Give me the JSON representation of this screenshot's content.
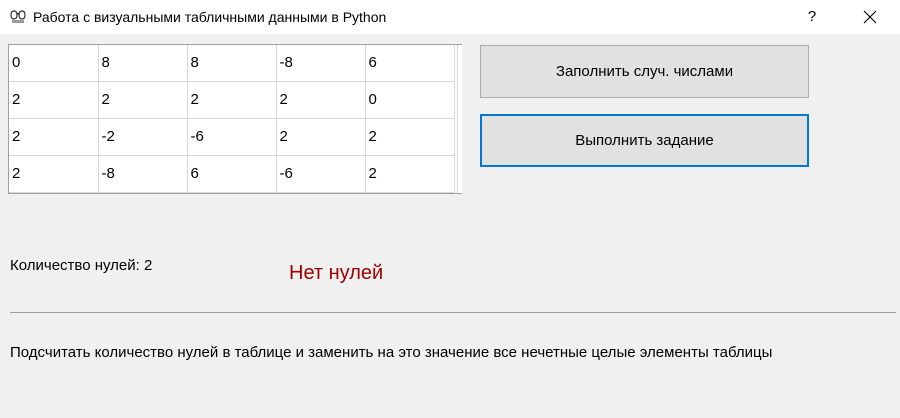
{
  "window": {
    "title": "Работа с визуальными табличными данными в Python",
    "help_label": "?",
    "icon": "glasses-icon"
  },
  "table": {
    "rows": [
      [
        "0",
        "8",
        "8",
        "-8",
        "6"
      ],
      [
        "2",
        "2",
        "2",
        "2",
        "0"
      ],
      [
        "2",
        "-2",
        "-6",
        "2",
        "2"
      ],
      [
        "2",
        "-8",
        "6",
        "-6",
        "2"
      ]
    ]
  },
  "buttons": {
    "fill_random": "Заполнить случ. числами",
    "run_task": "Выполнить задание"
  },
  "results": {
    "zero_count_text": "Количество нулей: 2",
    "status_text": "Нет нулей",
    "status_color": "#a00000"
  },
  "task": {
    "description": "Подсчитать количество нулей в таблице и заменить на это значение все нечетные целые элементы таблицы"
  },
  "colors": {
    "accent": "#0078d7",
    "window_bg": "#f0f0f0"
  }
}
